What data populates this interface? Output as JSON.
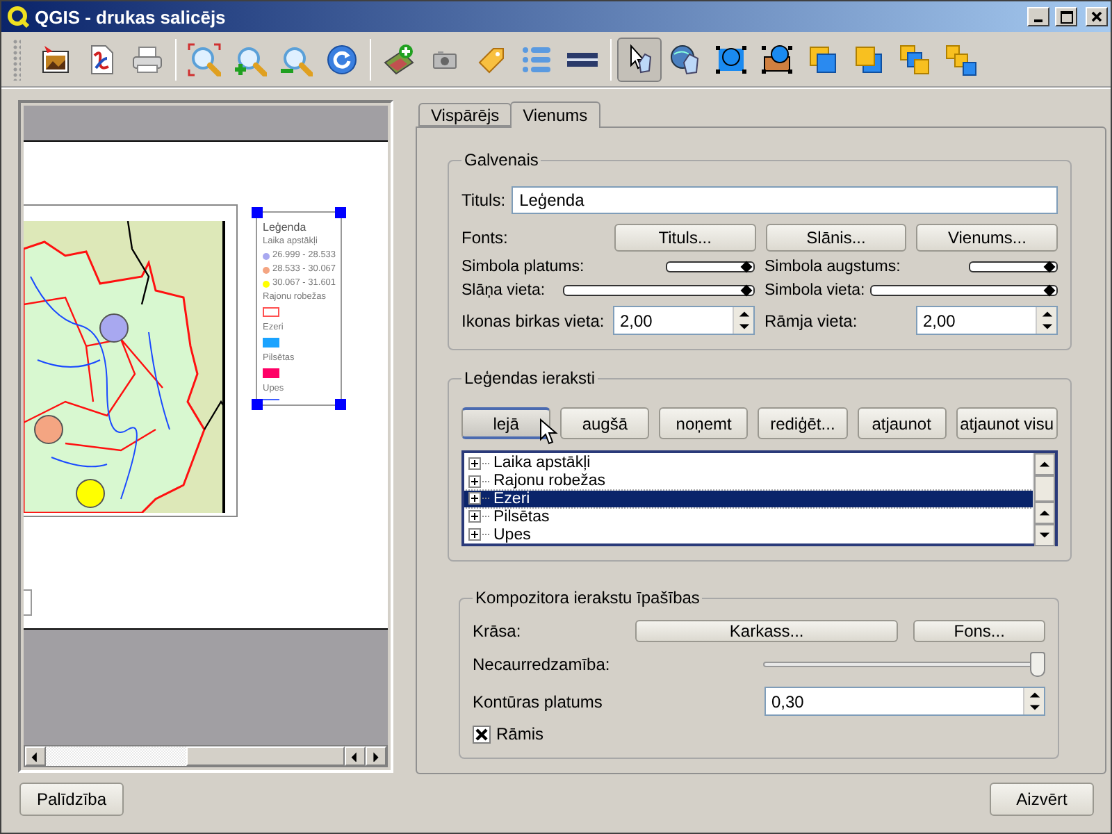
{
  "window": {
    "title": "QGIS - drukas salicējs"
  },
  "toolbar": [
    {
      "kind": "export-image",
      "selected": false
    },
    {
      "kind": "export-svg",
      "selected": false
    },
    {
      "kind": "print",
      "selected": false
    },
    {
      "kind": "zoom-full",
      "selected": false
    },
    {
      "kind": "zoom-in",
      "selected": false
    },
    {
      "kind": "zoom-out",
      "selected": false
    },
    {
      "kind": "refresh",
      "selected": false
    },
    {
      "kind": "add-map",
      "selected": false
    },
    {
      "kind": "add-image",
      "selected": false
    },
    {
      "kind": "add-label",
      "selected": false
    },
    {
      "kind": "add-legend",
      "selected": false
    },
    {
      "kind": "add-scalebar",
      "selected": false
    },
    {
      "kind": "select",
      "selected": true
    },
    {
      "kind": "move-content",
      "selected": false
    },
    {
      "kind": "shape-blue",
      "selected": false
    },
    {
      "kind": "shape-orange",
      "selected": false
    },
    {
      "kind": "raise",
      "selected": false
    },
    {
      "kind": "lower",
      "selected": false
    },
    {
      "kind": "group",
      "selected": false
    },
    {
      "kind": "ungroup",
      "selected": false
    }
  ],
  "composer": {
    "legend": {
      "title": "Leģenda",
      "groups": [
        {
          "name": "Laika apstākļi",
          "items": [
            {
              "label": "26.999 - 28.533",
              "color": "#a8a8f0"
            },
            {
              "label": "28.533 - 30.067",
              "color": "#f4a582"
            },
            {
              "label": "30.067 - 31.601",
              "color": "#ffff00"
            }
          ]
        },
        {
          "name": "Rajonu robežas",
          "symbol": {
            "kind": "outline",
            "color": "#ff5050"
          }
        },
        {
          "name": "Ezeri",
          "symbol": {
            "kind": "fill",
            "color": "#1aa3ff"
          }
        },
        {
          "name": "Pilsētas",
          "symbol": {
            "kind": "fill",
            "color": "#ff0066"
          }
        },
        {
          "name": "Upes",
          "symbol": {
            "kind": "line",
            "color": "#4060ff"
          }
        }
      ]
    }
  },
  "tabs": [
    {
      "label": "Vispārējs",
      "selected": false
    },
    {
      "label": "Vienums",
      "selected": true
    }
  ],
  "main_group": {
    "title": "Galvenais",
    "title_label": "Tituls:",
    "title_value": "Leģenda",
    "fonts_label": "Fonts:",
    "font_buttons": [
      "Tituls...",
      "Slānis...",
      "Vienums..."
    ],
    "spin_rows": [
      [
        {
          "label": "Simbola platums:",
          "level": 1
        },
        {
          "label": "Simbola augstums:",
          "level": 1
        }
      ],
      [
        {
          "label": "Slāņa vieta:",
          "level": 1
        },
        {
          "label": "Simbola vieta:",
          "level": 1
        }
      ]
    ],
    "spacing": [
      {
        "label": "Ikonas birkas vieta:",
        "value": "2,00"
      },
      {
        "label": "Rāmja vieta:",
        "value": "2,00"
      }
    ]
  },
  "entries_group": {
    "title": "Leģendas ieraksti",
    "buttons": [
      {
        "label": "lejā",
        "hovered": true
      },
      {
        "label": "augšā",
        "hovered": false
      },
      {
        "label": "noņemt",
        "hovered": false
      },
      {
        "label": "rediģēt...",
        "hovered": false
      },
      {
        "label": "atjaunot",
        "hovered": false
      },
      {
        "label": "atjaunot visu",
        "hovered": false
      }
    ],
    "items": [
      {
        "label": "Laika apstākļi",
        "selected": false
      },
      {
        "label": "Rajonu robežas",
        "selected": false
      },
      {
        "label": "Ezeri",
        "selected": true
      },
      {
        "label": "Pilsētas",
        "selected": false
      },
      {
        "label": "Upes",
        "selected": false
      }
    ]
  },
  "properties_group": {
    "title": "Kompozitora ierakstu īpašības",
    "color_label": "Krāsa:",
    "color_buttons": [
      "Karkass...",
      "Fons..."
    ],
    "opacity": {
      "label": "Necaurredzamība:",
      "level": 1
    },
    "outline": {
      "label": "Kontūras platums",
      "value": "0,30"
    },
    "frame": {
      "label": "Rāmis",
      "checked": true
    }
  },
  "footer": {
    "help": "Palīdzība",
    "close": "Aizvērt"
  }
}
